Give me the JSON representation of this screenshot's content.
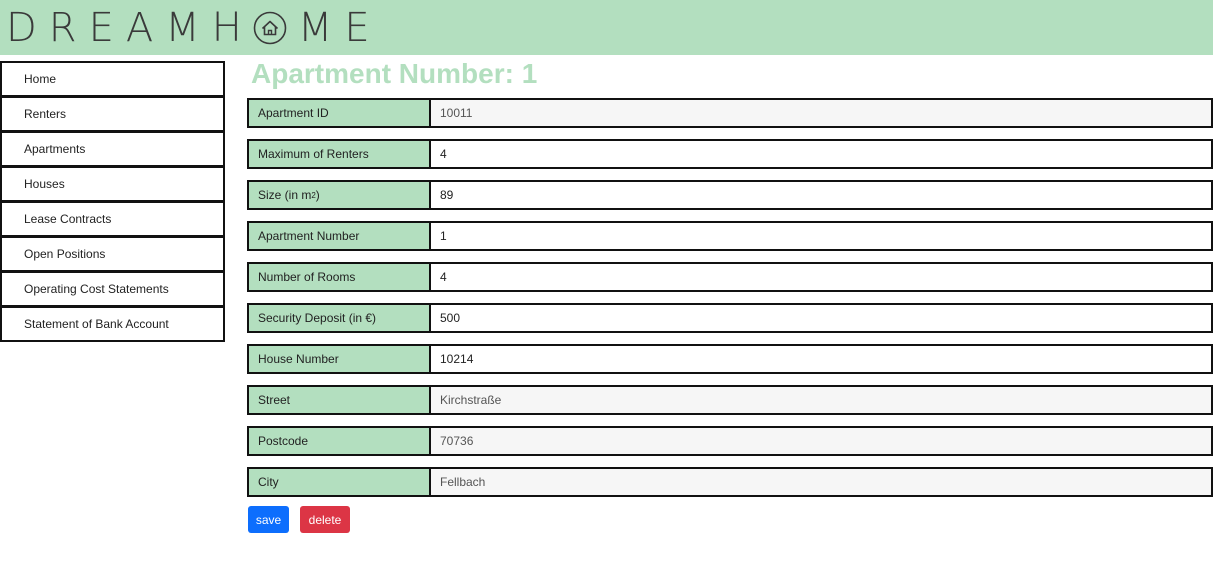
{
  "header": {
    "logo_left": "DREAMH",
    "logo_right": "ME",
    "logo_icon": "house-in-circle-icon",
    "background_color": "#b3dfbf"
  },
  "sidebar": {
    "items": [
      {
        "label": "Home"
      },
      {
        "label": "Renters"
      },
      {
        "label": "Apartments"
      },
      {
        "label": "Houses"
      },
      {
        "label": "Lease Contracts"
      },
      {
        "label": "Open Positions"
      },
      {
        "label": "Operating Cost Statements"
      },
      {
        "label": "Statement of Bank Account"
      }
    ]
  },
  "main": {
    "title": "Apartment Number: 1",
    "title_color": "#b3dfbf",
    "fields": [
      {
        "label": "Apartment ID",
        "value": "10011",
        "editable": false
      },
      {
        "label": "Maximum of Renters",
        "value": "4",
        "editable": true
      },
      {
        "label": "Size (in m",
        "label_sup": "2",
        "label_suffix": ")",
        "value": "89",
        "editable": true
      },
      {
        "label": "Apartment Number",
        "value": "1",
        "editable": true
      },
      {
        "label": "Number of Rooms",
        "value": "4",
        "editable": true
      },
      {
        "label": "Security Deposit (in €)",
        "value": "500",
        "editable": true
      },
      {
        "label": "House Number",
        "value": "10214",
        "editable": true
      },
      {
        "label": "Street",
        "value": "Kirchstraße",
        "editable": false
      },
      {
        "label": "Postcode",
        "value": "70736",
        "editable": false
      },
      {
        "label": "City",
        "value": "Fellbach",
        "editable": false
      }
    ]
  },
  "buttons": {
    "save_label": "save",
    "save_color": "#0d6efd",
    "delete_label": "delete",
    "delete_color": "#dc3545"
  }
}
